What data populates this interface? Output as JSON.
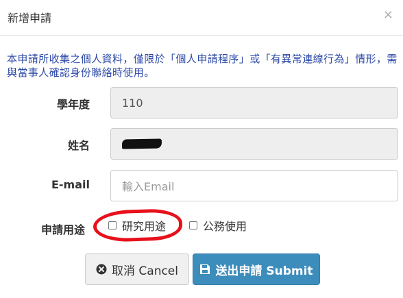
{
  "modal": {
    "title": "新增申請",
    "close_glyph": "×"
  },
  "notice": "本申請所收集之個人資料，僅限於「個人申請程序」或「有異常連線行為」情形，需與當事人確認身份聯絡時使用。",
  "form": {
    "school_year": {
      "label": "學年度",
      "value": "110"
    },
    "name": {
      "label": "姓名",
      "value": ""
    },
    "email": {
      "label": "E-mail",
      "placeholder": "輸入Email",
      "value": ""
    },
    "purpose": {
      "label": "申請用途",
      "options": [
        {
          "label": "研究用途",
          "checked": false
        },
        {
          "label": "公務使用",
          "checked": false
        }
      ]
    }
  },
  "buttons": {
    "cancel": {
      "label": "取消 Cancel",
      "icon": "times-circle-icon"
    },
    "submit": {
      "label": "送出申請 Submit",
      "icon": "floppy-disk-icon"
    }
  },
  "colors": {
    "notice_text": "#2d4aa8",
    "submit_bg": "#3c8dbc",
    "annotation": "#e8101b"
  }
}
